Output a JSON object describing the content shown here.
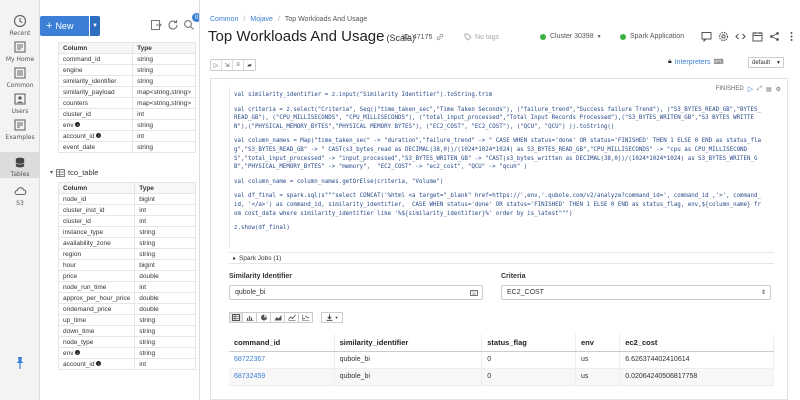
{
  "rail": [
    {
      "label": "Recent",
      "icon": "clock-icon"
    },
    {
      "label": "My Home",
      "icon": "home-icon"
    },
    {
      "label": "Common",
      "icon": "folder-icon"
    },
    {
      "label": "Users",
      "icon": "users-icon"
    },
    {
      "label": "Examples",
      "icon": "examples-icon"
    },
    {
      "label": "Tables",
      "icon": "database-icon"
    },
    {
      "label": "S3",
      "icon": "cloud-icon"
    }
  ],
  "panel": {
    "new_label": "New",
    "badge": "0",
    "table1": {
      "headers": [
        "Column",
        "Type"
      ],
      "rows": [
        [
          "command_id",
          "string"
        ],
        [
          "engine",
          "string"
        ],
        [
          "similarity_identifier",
          "string"
        ],
        [
          "similarity_payload",
          "map<string,string>"
        ],
        [
          "counters",
          "map<string,string>"
        ],
        [
          "cluster_id",
          "int"
        ],
        [
          "env",
          "string"
        ],
        [
          "account_id",
          "int"
        ],
        [
          "event_date",
          "string"
        ]
      ]
    },
    "table2_name": "tco_table",
    "table2": {
      "headers": [
        "Column",
        "Type"
      ],
      "rows": [
        [
          "node_id",
          "bigint"
        ],
        [
          "cluster_inst_id",
          "int"
        ],
        [
          "cluster_id",
          "int"
        ],
        [
          "instance_type",
          "string"
        ],
        [
          "availability_zone",
          "string"
        ],
        [
          "region",
          "string"
        ],
        [
          "hour",
          "bigint"
        ],
        [
          "price",
          "double"
        ],
        [
          "node_run_time",
          "int"
        ],
        [
          "approx_per_hour_price",
          "double"
        ],
        [
          "ondemand_price",
          "double"
        ],
        [
          "up_time",
          "string"
        ],
        [
          "down_time",
          "string"
        ],
        [
          "node_type",
          "string"
        ],
        [
          "env",
          "string"
        ],
        [
          "account_id",
          "int"
        ]
      ]
    }
  },
  "header": {
    "crumbs": [
      "Common",
      "Mojave",
      "Top Workloads And Usage"
    ],
    "title": "Top Workloads And Usage",
    "lang": "(Scala)",
    "id_label": "ID: 47175",
    "tags": "No tags",
    "cluster": "Cluster 30398",
    "app": "Spark Application",
    "interpreters": "Interpreters",
    "default": "default"
  },
  "paragraph": {
    "status": "FINISHED",
    "code": [
      "val similarity_identifier = z.input(\"Similarity Identifier\").toString.trim",
      "",
      "val criteria = z.select(\"Criteria\", Seq((\"time_taken_sec\",\"Time Taken Seconds\"), (\"failure_trend\",\"Success failure Trend\"), (\"S3_BYTES_READ_GB\",\"BYTES_READ_GB\"), (\"CPU_MILLISECONDS\", \"CPU_MILLISECONDS\"), (\"total_input_processed\",\"Total Input Records Processed\"),(\"S3_BYTES_WRITEN_GB\",\"S3 BYTES WRITTEN\"),(\"PHYSICAL_MEMORY_BYTES\",\"PHYSICAL MEMORY BYTES\"), (\"EC2_COST\", \"EC2_COST\"), (\"QCU\", \"QCU\") )).toString()",
      "",
      "val column_names = Map(\"time_taken_sec\" -> \"duration\",\"failure_trend\" -> \" CASE WHEN status='done' OR status='FINISHED' THEN 1 ELSE 0 END as status_flag\",\"S3_BYTES_READ_GB\" -> \" CAST(s3_bytes_read as DECIMAL(38,0))/(1024*1024*1024) as S3_BYTES_READ_GB\",\"CPU_MILLISECONDS\" -> \"cpu as CPU_MILLISECONDS\",\"total_input_processed\" -> \"input_processed\",\"S3_BYTES_WRITEN_GB\" -> \"CAST(s3_bytes_written as DECIMAL(38,0))/(1024*1024*1024) as S3_BYTES_WRITEN_GB\",\"PHYSICAL_MEMORY_BYTES\" -> \"memory\",  \"EC2_COST\" -> \"ec2_cost\", \"QCU\" -> \"qcuh\" )",
      "",
      "val column_name = column_names.getOrElse(criteria, \"Volume\")",
      "",
      "val df_final = spark.sql(s\"\"\"select CONCAT('%html <a target=\"_blank\" href=https://',env,'.qubole.com/v2/analyze?command_id=', command_id ,'>', command_id, '</a>') as command_id, similarity_identifier,  CASE WHEN status='done' OR status='FINISHED' THEN 1 ELSE 0 END as status_flag, env,${column_name} from cost_data where similarity_identifier like '%${similarity_identifier}%' order by is_latest\"\"\")",
      "",
      "z.show(df_final)"
    ],
    "spark_jobs": "Spark Jobs (1)",
    "similarity_label": "Similarity Identifier",
    "similarity_value": "qubole_bi",
    "criteria_label": "Criteria",
    "criteria_value": "EC2_COST",
    "results": {
      "headers": [
        "command_id",
        "similarity_identifier",
        "status_flag",
        "env",
        "ec2_cost"
      ],
      "rows": [
        [
          "68722367",
          "qubole_bi",
          "0",
          "us",
          "6.626374402410614"
        ],
        [
          "68732459",
          "qubole_bi",
          "0",
          "us",
          "0.02064240506817758"
        ]
      ]
    }
  }
}
